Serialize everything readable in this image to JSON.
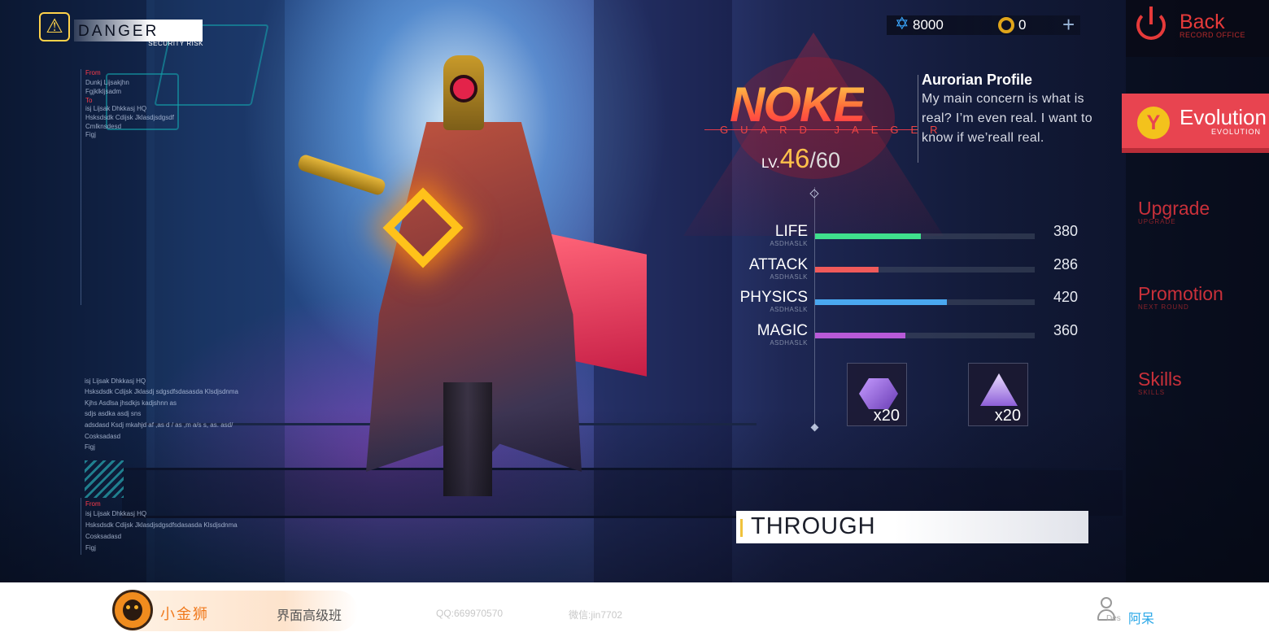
{
  "hud": {
    "warning_icon": "warning-triangle-icon",
    "danger_label": "DANGER",
    "danger_sub": "SECURITY RISK",
    "log_top": [
      "From",
      "Dunkj Lijsakjhn",
      "Fgjklkljsadm",
      "To",
      "isj Lijsak Dhkkasj HQ",
      "Hsksdsdk Cdijsk Jklasdjsdgsdf",
      "Cmlknsdesd",
      "Figj"
    ],
    "log_mid": [
      "isj Lijsak Dhkkasj HQ",
      "Hsksdsdk Cdijsk Jklasdj sdgsdfsdasasda Klsdjsdnma",
      "Kjhs Asdlsa jhsdkjs kadjshnn as",
      "sdjs asdka asdj sns",
      "adsdasd Ksdj mkahjd af ,as d / as ,m a/s s, as. asd/",
      "Cosksadasd",
      "Figj"
    ],
    "log_bottom": [
      "From",
      "isj Lijsak Dhkkasj HQ",
      "Hsksdsdk Cdijsk Jklasdjsdgsdfsdasasda Klsdjsdnma",
      "Cosksadasd",
      "Figj"
    ]
  },
  "currency": {
    "star_icon": "star-of-david-icon",
    "stars": "8000",
    "coin_icon": "coin-icon",
    "coins": "0",
    "add_icon": "plus-icon"
  },
  "nav": {
    "back_icon": "power-icon",
    "back_label": "Back",
    "back_sub": "RECORD OFFICE",
    "evolution_icon": "evolution-y-icon",
    "evolution_glyph": "Y",
    "evolution_label": "Evolution",
    "evolution_sub": "EVOLUTION",
    "items": [
      {
        "label": "Upgrade",
        "sub": "UPGRADE"
      },
      {
        "label": "Promotion",
        "sub": "NEXT ROUND"
      },
      {
        "label": "Skills",
        "sub": "SKILLS"
      }
    ]
  },
  "profile": {
    "name": "NOKE",
    "subtitle": "GUARD JAEGER",
    "level_prefix": "LV.",
    "level": "46",
    "level_max": "/60",
    "title": "Aurorian Profile",
    "description": "My main concern is what is real? I’m even real. I want to know if we’reall real."
  },
  "stats": [
    {
      "name": "LIFE",
      "sub": "ASDHASLK",
      "value": "380",
      "fraction": 0.48,
      "color": "#3fe08d"
    },
    {
      "name": "ATTACK",
      "sub": "ASDHASLK",
      "value": "286",
      "fraction": 0.29,
      "color": "#f05a5a"
    },
    {
      "name": "PHYSICS",
      "sub": "ASDHASLK",
      "value": "420",
      "fraction": 0.6,
      "color": "#4aa8f0"
    },
    {
      "name": "MAGIC",
      "sub": "ASDHASLK",
      "value": "360",
      "fraction": 0.41,
      "color": "#b85ad8"
    }
  ],
  "inventory": [
    {
      "icon": "purple-claw-hexagon-icon",
      "quantity": "x20"
    },
    {
      "icon": "purple-triangle-crystal-icon",
      "quantity": "x20"
    }
  ],
  "through_label": "THROUGH",
  "footer": {
    "logo_icon": "lion-logo-icon",
    "brand": "小金狮",
    "course": "界面高级班",
    "qq": "QQ:669970570",
    "wechat": "微信:jin7702",
    "user_icon": "user-icon",
    "des": "Des",
    "username": "阿呆"
  }
}
